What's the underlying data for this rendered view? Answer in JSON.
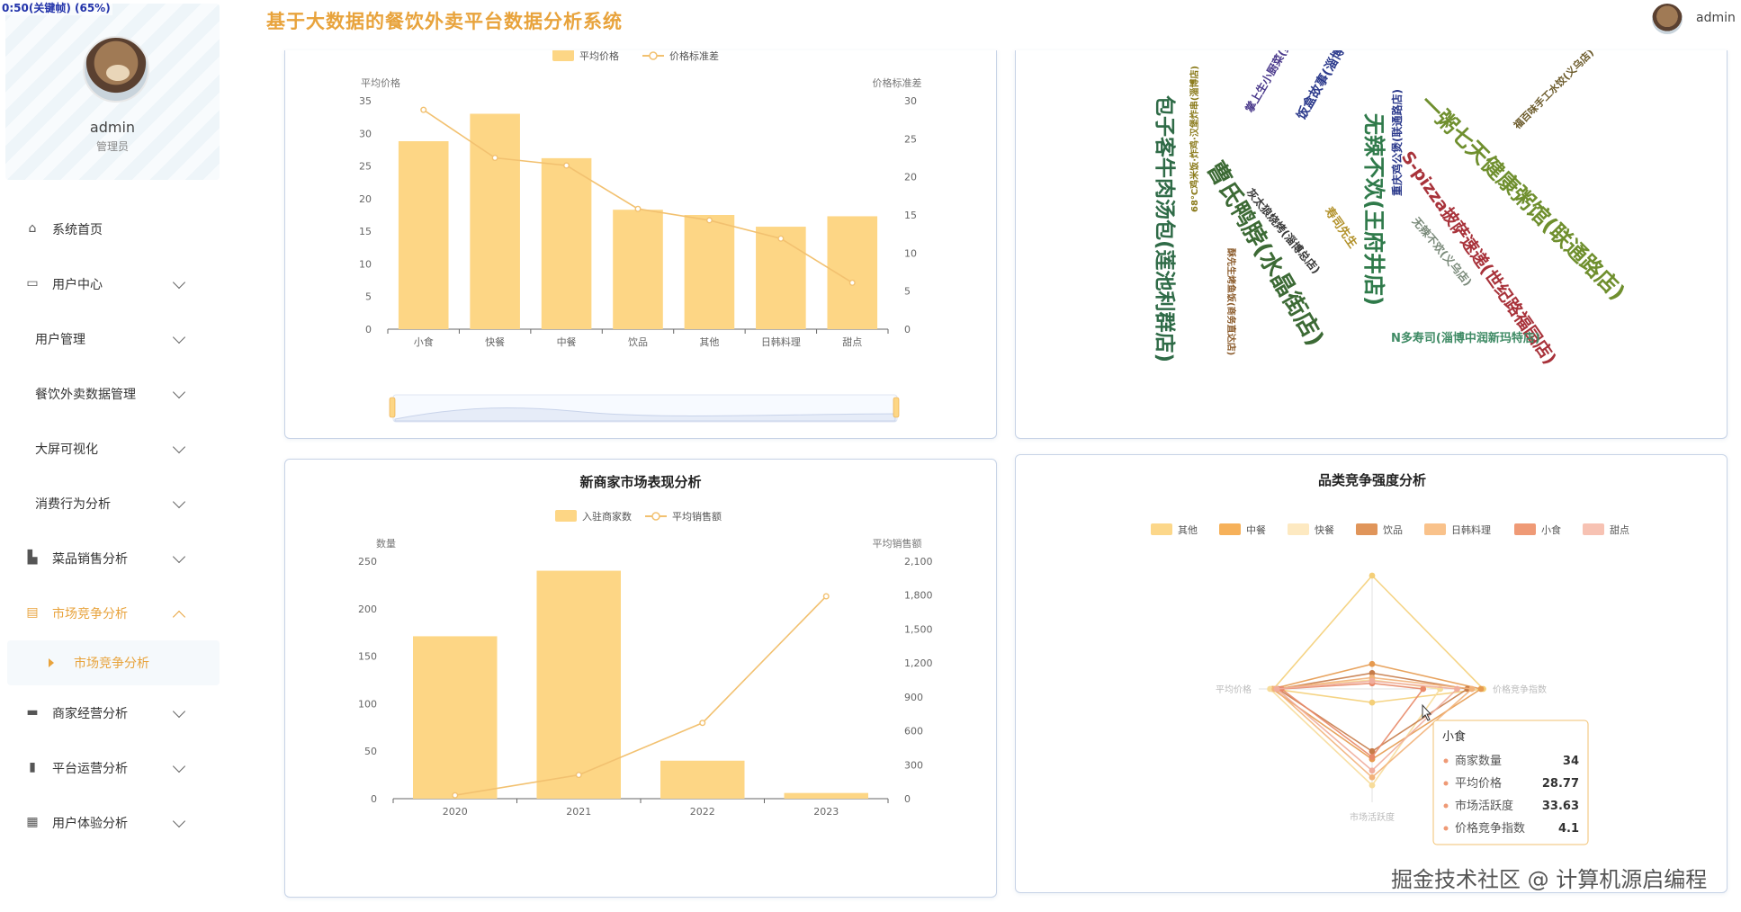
{
  "app": {
    "title": "基于大数据的餐饮外卖平台数据分析系统",
    "timer": "0:50(关键帧) (65%)"
  },
  "header": {
    "user": "admin"
  },
  "profile": {
    "name": "admin",
    "role": "管理员"
  },
  "menu": {
    "items": [
      {
        "label": "系统首页",
        "icon": "home-icon"
      },
      {
        "label": "用户中心",
        "icon": "card-icon"
      },
      {
        "label": "用户管理"
      },
      {
        "label": "餐饮外卖数据管理"
      },
      {
        "label": "大屏可视化"
      },
      {
        "label": "消费行为分析"
      },
      {
        "label": "菜品销售分析",
        "icon": "bag-icon"
      },
      {
        "label": "市场竞争分析",
        "icon": "clipboard-icon"
      },
      {
        "label": "商家经营分析",
        "icon": "monitor-icon"
      },
      {
        "label": "平台运营分析",
        "icon": "bar-icon"
      },
      {
        "label": "用户体验分析",
        "icon": "grid-icon"
      }
    ],
    "active_sub": "市场竞争分析"
  },
  "colors": {
    "accent": "#e8a33c",
    "bar": "#fdd685",
    "line": "#f2c170",
    "border": "#c7d3e6"
  },
  "chart_data": [
    {
      "type": "bar",
      "title": "",
      "legend": [
        "平均价格",
        "价格标准差"
      ],
      "categories": [
        "小食",
        "快餐",
        "中餐",
        "饮品",
        "其他",
        "日韩料理",
        "甜点"
      ],
      "series": [
        {
          "name": "平均价格",
          "kind": "bar",
          "axis": "left",
          "values": [
            28.8,
            33.0,
            26.2,
            18.3,
            17.5,
            15.7,
            17.3
          ]
        },
        {
          "name": "价格标准差",
          "kind": "line",
          "axis": "right",
          "values": [
            28.8,
            22.5,
            21.5,
            15.8,
            14.3,
            11.9,
            6.1
          ]
        }
      ],
      "ylabel_left": "平均价格",
      "ylim_left": [
        0,
        35
      ],
      "yticks_left": [
        "0",
        "5",
        "10",
        "15",
        "20",
        "25",
        "30",
        "35"
      ],
      "ylabel_right": "价格标准差",
      "ylim_right": [
        0,
        30
      ],
      "yticks_right": [
        "0",
        "5",
        "10",
        "15",
        "20",
        "25",
        "30"
      ],
      "has_datazoom": true
    },
    {
      "type": "wordcloud",
      "words": [
        {
          "text": "包子客牛肉汤包(莲池利群店)",
          "color": "#2f6b47"
        },
        {
          "text": "曹氏鸭脖(水晶街店)",
          "color": "#3c6a35"
        },
        {
          "text": "无辣不欢(王府井店)",
          "color": "#2f7a4a"
        },
        {
          "text": "一粥七天健康粥馆(联通路店)",
          "color": "#6f8f2e"
        },
        {
          "text": "S-pizza披萨速递(世纪路福园店)",
          "color": "#a8323a"
        },
        {
          "text": "饭盒故事(淄博店)",
          "color": "#2c3a8c"
        },
        {
          "text": "寿司先生",
          "color": "#b2912a"
        },
        {
          "text": "掌上生小厨菜(步行街店)",
          "color": "#4b3a8c"
        },
        {
          "text": "灰太狼烧烤(淄博总店)",
          "color": "#3a3a3a"
        },
        {
          "text": "N多寿司(淄博中润新玛特店)",
          "color": "#3e8a64"
        },
        {
          "text": "重庆鸡公煲(联通路店)",
          "color": "#2c3a8c"
        },
        {
          "text": "无辣不欢(义乌店)",
          "color": "#7a8a7a"
        },
        {
          "text": "福百味手工水饺(义乌店)",
          "color": "#6b5a2a"
        },
        {
          "text": "酥先生烤鱼饭(商务直达店)",
          "color": "#8a5a2a"
        },
        {
          "text": "68°C鸡米饭·炸鸡·汉堡炸串(淄博店)",
          "color": "#8a7a1a"
        }
      ]
    },
    {
      "type": "bar",
      "title": "新商家市场表现分析",
      "legend": [
        "入驻商家数",
        "平均销售额"
      ],
      "categories": [
        "2020",
        "2021",
        "2022",
        "2023"
      ],
      "series": [
        {
          "name": "入驻商家数",
          "kind": "bar",
          "axis": "left",
          "values": [
            171,
            240,
            40,
            6
          ]
        },
        {
          "name": "平均销售额",
          "kind": "line",
          "axis": "right",
          "values": [
            30,
            210,
            670,
            1790
          ]
        }
      ],
      "ylabel_left": "数量",
      "ylim_left": [
        0,
        250
      ],
      "yticks_left": [
        "0",
        "50",
        "100",
        "150",
        "200",
        "250"
      ],
      "ylabel_right": "平均销售额",
      "ylim_right": [
        0,
        2100
      ],
      "yticks_right": [
        "0",
        "300",
        "600",
        "900",
        "1,200",
        "1,500",
        "1,800",
        "2,100"
      ]
    },
    {
      "type": "radar",
      "title": "品类竞争强度分析",
      "legend": [
        "其他",
        "中餐",
        "快餐",
        "饮品",
        "日韩料理",
        "小食",
        "甜点"
      ],
      "legend_colors": [
        "#fcd78a",
        "#f6b15a",
        "#fde9c1",
        "#e0955a",
        "#f9c28b",
        "#ef9a76",
        "#f7c2b3"
      ],
      "indicators": [
        "商家数量",
        "价格竞争指数",
        "市场活跃度",
        "平均价格"
      ],
      "axis_labels": {
        "left": "平均价格",
        "right": "价格竞争指数",
        "bottom": "市场活跃度"
      },
      "series": [
        {
          "name": "其他",
          "values": [
            1.0,
            0.98,
            0.12,
            0.87
          ]
        },
        {
          "name": "中餐",
          "values": [
            0.22,
            0.96,
            0.62,
            0.88
          ]
        },
        {
          "name": "快餐",
          "values": [
            0.08,
            0.6,
            0.85,
            0.9
          ]
        },
        {
          "name": "饮品",
          "values": [
            0.14,
            0.84,
            0.55,
            0.83
          ]
        },
        {
          "name": "日韩料理",
          "values": [
            0.1,
            0.88,
            0.78,
            0.86
          ]
        },
        {
          "name": "小食",
          "values": [
            0.05,
            0.45,
            0.6,
            0.8
          ]
        },
        {
          "name": "甜点",
          "values": [
            0.07,
            0.75,
            0.72,
            0.84
          ]
        }
      ],
      "tooltip": {
        "title": "小食",
        "rows": [
          {
            "label": "商家数量",
            "value": "34"
          },
          {
            "label": "平均价格",
            "value": "28.77"
          },
          {
            "label": "市场活跃度",
            "value": "33.63"
          },
          {
            "label": "价格竞争指数",
            "value": "4.1"
          }
        ]
      }
    }
  ],
  "watermark": "掘金技术社区 @ 计算机源启编程"
}
